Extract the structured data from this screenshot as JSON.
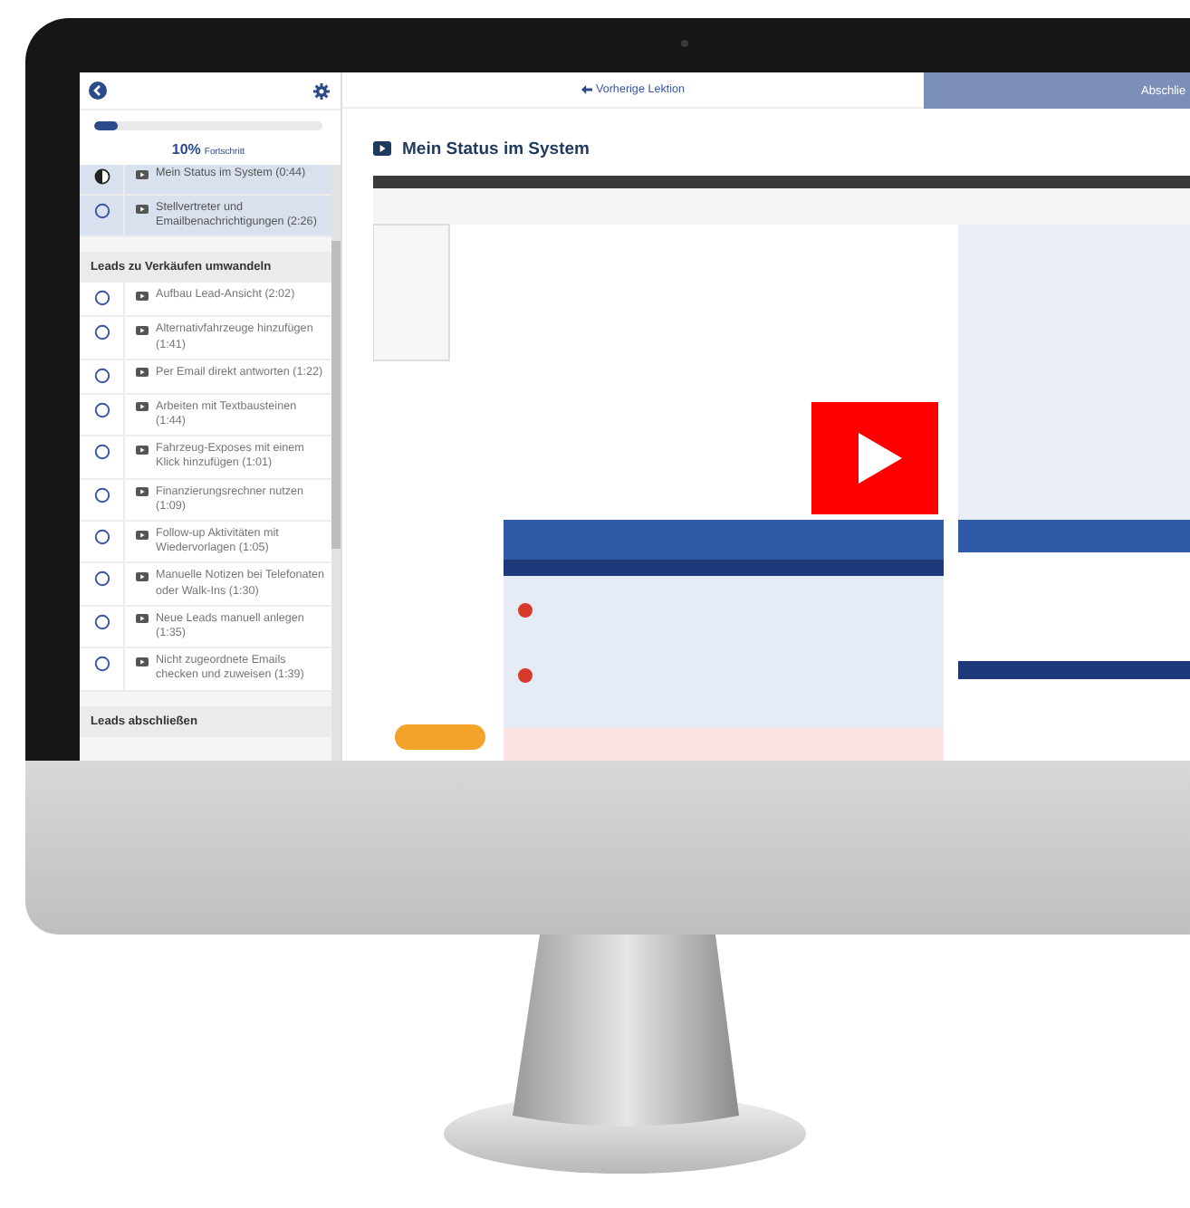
{
  "sidebar": {
    "progress": {
      "level": 0.1,
      "percent": "10%",
      "label": "Fortschritt"
    },
    "items": [
      {
        "kind": "lesson",
        "title": "Mein Status im System (0:44)",
        "started": true,
        "selected": true
      },
      {
        "kind": "lesson",
        "title": "Stellvertreter und Emailbenachrichtigungen (2:26)",
        "started": false,
        "selected": true
      },
      {
        "kind": "section",
        "title": "Leads zu Verkäufen umwandeln"
      },
      {
        "kind": "lesson",
        "title": "Aufbau Lead-Ansicht (2:02)",
        "started": false,
        "selected": false
      },
      {
        "kind": "lesson",
        "title": "Alternativfahrzeuge hinzufügen (1:41)",
        "started": false,
        "selected": false
      },
      {
        "kind": "lesson",
        "title": "Per Email direkt antworten (1:22)",
        "started": false,
        "selected": false
      },
      {
        "kind": "lesson",
        "title": "Arbeiten mit Textbausteinen (1:44)",
        "started": false,
        "selected": false
      },
      {
        "kind": "lesson",
        "title": "Fahrzeug-Exposes mit einem Klick hinzufügen (1:01)",
        "started": false,
        "selected": false
      },
      {
        "kind": "lesson",
        "title": "Finanzierungsrechner nutzen (1:09)",
        "started": false,
        "selected": false
      },
      {
        "kind": "lesson",
        "title": "Follow-up Aktivitäten mit Wiedervorlagen (1:05)",
        "started": false,
        "selected": false
      },
      {
        "kind": "lesson",
        "title": "Manuelle Notizen bei Telefonaten oder Walk-Ins (1:30)",
        "started": false,
        "selected": false
      },
      {
        "kind": "lesson",
        "title": "Neue Leads manuell anlegen (1:35)",
        "started": false,
        "selected": false
      },
      {
        "kind": "lesson",
        "title": "Nicht zugeordnete Emails checken und zuweisen (1:39)",
        "started": false,
        "selected": false
      },
      {
        "kind": "section",
        "title": "Leads abschließen"
      }
    ]
  },
  "nav": {
    "previous": "Vorherige Lektion",
    "complete": "Abschlie"
  },
  "lesson": {
    "title": "Mein Status im System"
  }
}
